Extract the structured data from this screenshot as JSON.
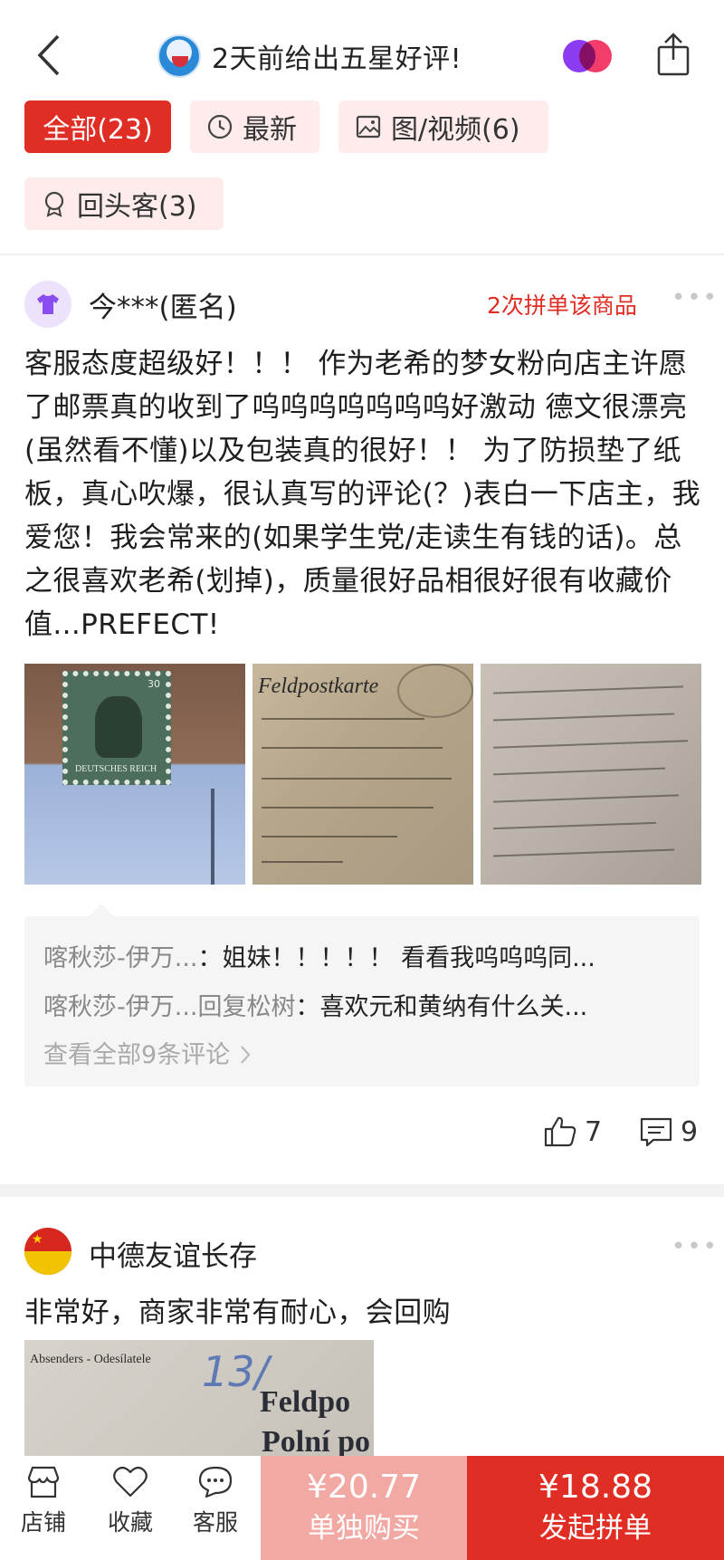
{
  "header": {
    "title": "2天前给出五星好评!",
    "back_icon": "chevron-left-icon",
    "share_icon": "share-icon"
  },
  "tabs": [
    {
      "label": "全部(23)",
      "active": true
    },
    {
      "label": "最新",
      "icon": "clock-icon"
    },
    {
      "label": "图/视频(6)",
      "icon": "image-icon"
    },
    {
      "label": "回头客(3)",
      "icon": "medal-icon"
    }
  ],
  "reviews": [
    {
      "user": "今***(匿名)",
      "tag": "2次拼单该商品",
      "text": "客服态度超级好！！！ 作为老希的梦女粉向店主许愿了邮票真的收到了呜呜呜呜呜呜呜好激动 德文很漂亮(虽然看不懂)以及包装真的很好！！ 为了防损垫了纸板，真心吹爆，很认真写的评论(？)表白一下店主，我爱您！我会常来的(如果学生党/走读生有钱的话)。总之很喜欢老希(划掉)，质量很好品相很好很有收藏价值...PREFECT!",
      "photos": [
        {
          "stamp_text": "DEUTSCHES REICH",
          "stamp_value": "30"
        },
        {
          "title": "Feldpostkarte"
        },
        {
          "desc": "handwriting"
        }
      ],
      "comments": [
        {
          "user": "喀秋莎-伊万...",
          "sep": "：",
          "text": "姐妹！！！！！ 看看我呜呜呜同..."
        },
        {
          "user": "喀秋莎-伊万...",
          "reply_to": "回复松树",
          "sep": "：",
          "text": "喜欢元和黄纳有什么关..."
        }
      ],
      "view_all": "查看全部9条评论",
      "likes": "7",
      "comment_count": "9"
    },
    {
      "user": "中德友谊长存",
      "text": "非常好，商家非常有耐心，会回购",
      "photo": {
        "line1": "Feldpo",
        "line2": "Polní po",
        "number": "13/",
        "sender": "Absenders - Odesílatele"
      }
    }
  ],
  "bottom_bar": {
    "shop": "店铺",
    "favorite": "收藏",
    "service": "客服",
    "solo_price": "¥20.77",
    "solo_label": "单独购买",
    "group_price": "¥18.88",
    "group_label": "发起拼单"
  },
  "colors": {
    "accent": "#e02e24",
    "accent_light": "#f2a8a3",
    "tab_bg": "#fdeceb"
  }
}
